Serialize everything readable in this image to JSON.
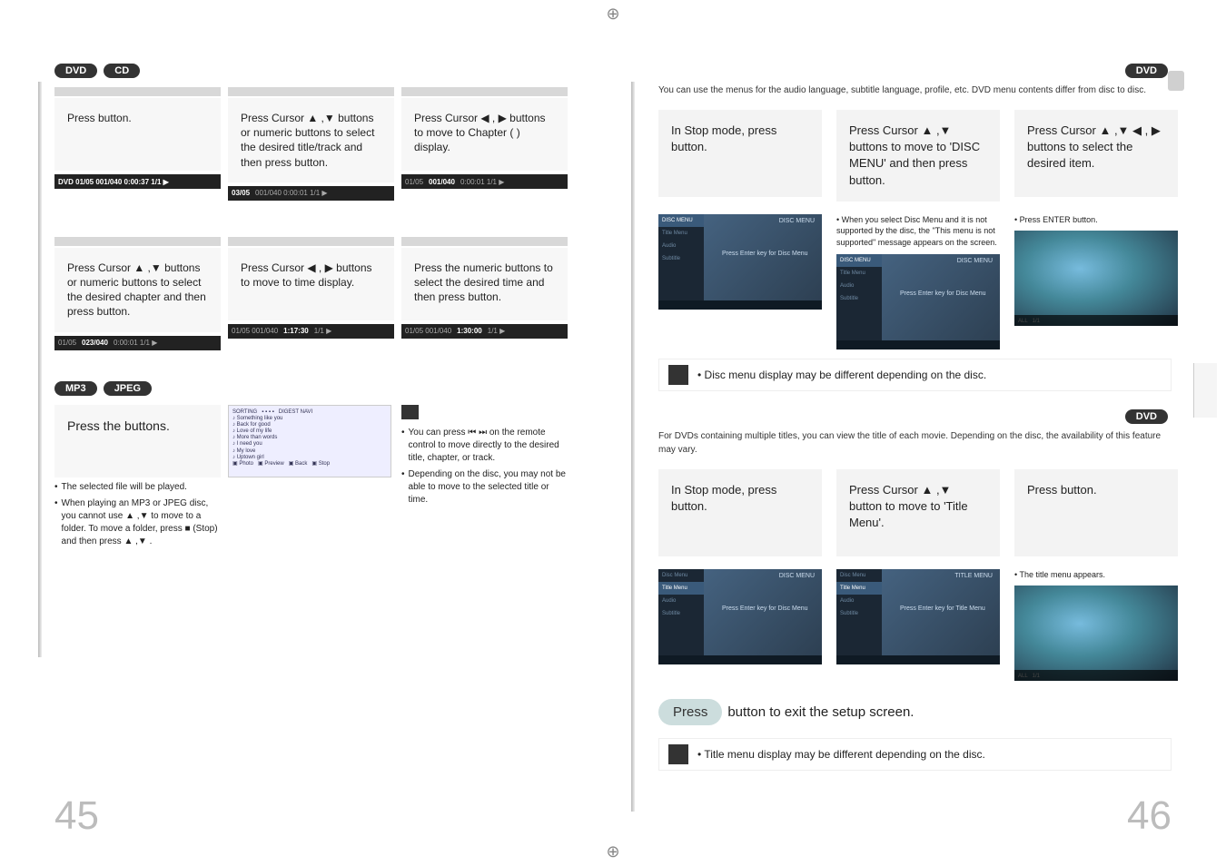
{
  "left": {
    "tags": {
      "dvd": "DVD",
      "cd": "CD",
      "mp3": "MP3",
      "jpeg": "JPEG"
    },
    "grid1": {
      "c1": "Press           button.",
      "c2": "Press Cursor ▲ ,▼ buttons or numeric buttons to select the desired title/track and then press          button.",
      "c3": "Press Cursor ◀ , ▶ buttons to move to Chapter (    ) display."
    },
    "osd1": {
      "c1": "DVD   01/05   001/040  0:00:37   1/1 ▶",
      "c2": "03/05",
      "c3": "001/040"
    },
    "grid2": {
      "c1": "Press Cursor ▲ ,▼ buttons or numeric buttons to select the desired chapter and then press          button.",
      "c2": "Press Cursor ◀ , ▶ buttons to move to time display.",
      "c3": "Press the numeric buttons to select the desired time and then press          button."
    },
    "osd2": {
      "c1": "023/040",
      "c2": "1:17:30",
      "c3": "1:30:00"
    },
    "media": {
      "title": "Press the          buttons.",
      "bullet1": "The selected file will be played.",
      "bullet2": "When playing an MP3 or JPEG disc, you cannot use ▲ ,▼ to move to a folder. To move a folder, press ■ (Stop) and then press ▲ ,▼ .",
      "noteLabel": "",
      "nbullet1": "You can press ⏮ ⏭ on the remote control to move directly to the desired title, chapter, or track.",
      "nbullet2": "Depending on the disc, you may not be able to move to the selected title or time."
    },
    "pageNum": "45"
  },
  "right": {
    "tags": {
      "dvd": "DVD"
    },
    "disc": {
      "intro": "You can use the menus for the audio language, subtitle language, profile, etc. DVD menu contents differ from disc to disc.",
      "c1": "In Stop mode, press button.",
      "c2": "Press Cursor ▲ ,▼ buttons to move to 'DISC MENU' and then press          button.",
      "c3": "Press Cursor ▲ ,▼ ◀ , ▶ buttons to select the desired item.",
      "note2": "When you select Disc Menu and it is not supported by the disc, the \"This menu is not supported\" message appears on the screen.",
      "note3": "Press ENTER button.",
      "screenMsg": "Press Enter key for Disc Menu",
      "screenTitle": "DISC MENU",
      "callout": "Disc menu display may be different depending on the disc."
    },
    "title": {
      "intro": "For DVDs containing multiple titles, you can view the title of each movie. Depending on the disc, the availability of this feature may vary.",
      "c1": "In Stop mode, press          button.",
      "c2": "Press Cursor ▲ ,▼ button to move to 'Title Menu'.",
      "c3": "Press           button.",
      "note3": "The title menu appears.",
      "screenMsg1": "Press Enter key for Disc Menu",
      "screenTitle1": "DISC MENU",
      "screenMsg2": "Press Enter key for Title Menu",
      "screenTitle2": "TITLE MENU",
      "exit": "button to exit the setup screen.",
      "exitLabel": "Press",
      "callout": "Title menu display may be different depending on the disc."
    },
    "pageNum": "46"
  }
}
